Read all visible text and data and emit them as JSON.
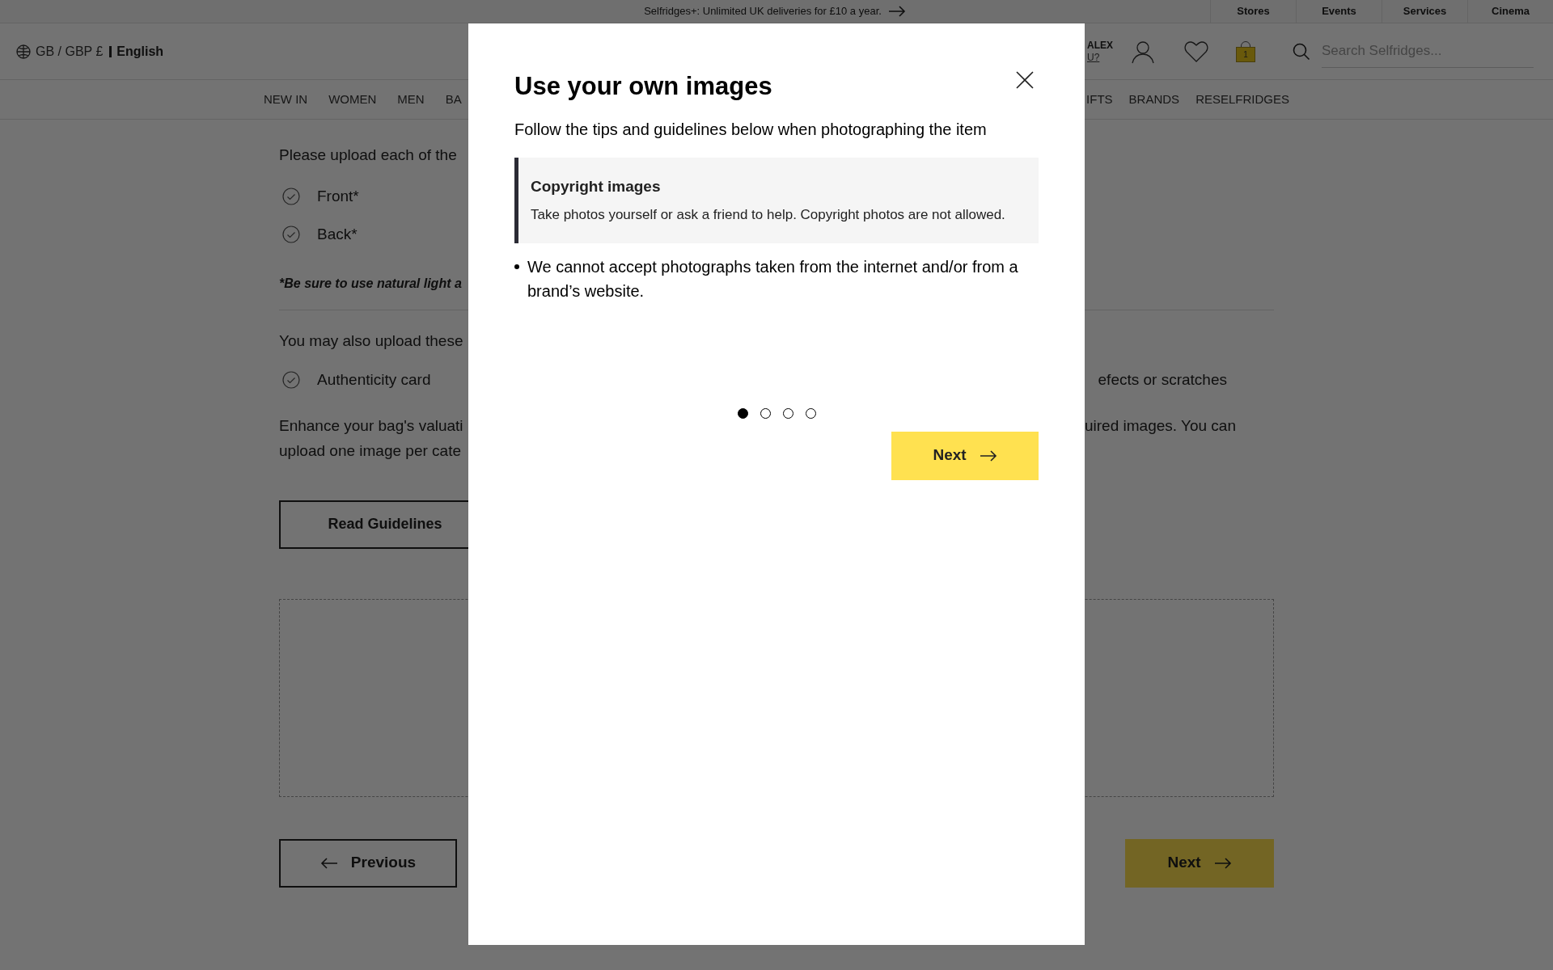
{
  "promo_bar": {
    "text": "Selfridges+: Unlimited UK deliveries for £10 a year.",
    "links": [
      "Stores",
      "Events",
      "Services",
      "Cinema"
    ]
  },
  "header": {
    "locale": "GB / GBP £",
    "language": "English",
    "greeting": "ALEX",
    "greeting_link": "U?",
    "bag_count": "1",
    "search": {
      "placeholder": "Search Selfridges..."
    }
  },
  "nav_left": [
    "NEW IN",
    "WOMEN",
    "MEN",
    "BA"
  ],
  "nav_right": [
    "IFTS",
    "BRANDS",
    "RESELFRIDGES"
  ],
  "page": {
    "intro": "Please upload each of the",
    "required": [
      "Front*",
      "Back*"
    ],
    "note": "*Be sure to use natural light a",
    "optional_intro": "You may also upload these",
    "optional_left": "Authenticity card",
    "optional_right": "efects or scratches",
    "enhance_left": [
      "Enhance your bag's valuati",
      "upload one image per cate"
    ],
    "enhance_right": "uired images. You can",
    "guidelines_button": "Read Guidelines",
    "previous_button": "Previous",
    "next_button": "Next"
  },
  "modal": {
    "title": "Use your own images",
    "subtitle": "Follow the tips and guidelines below when photographing the item",
    "callout": {
      "title": "Copyright images",
      "text": "Take photos yourself or ask a friend to help. Copyright photos are not allowed."
    },
    "bullets": [
      "We cannot accept photographs taken from the internet and/or from a brand’s website."
    ],
    "pager": [
      {
        "selected": true
      },
      {
        "selected": false
      },
      {
        "selected": false
      },
      {
        "selected": false
      }
    ],
    "next_button": "Next"
  }
}
